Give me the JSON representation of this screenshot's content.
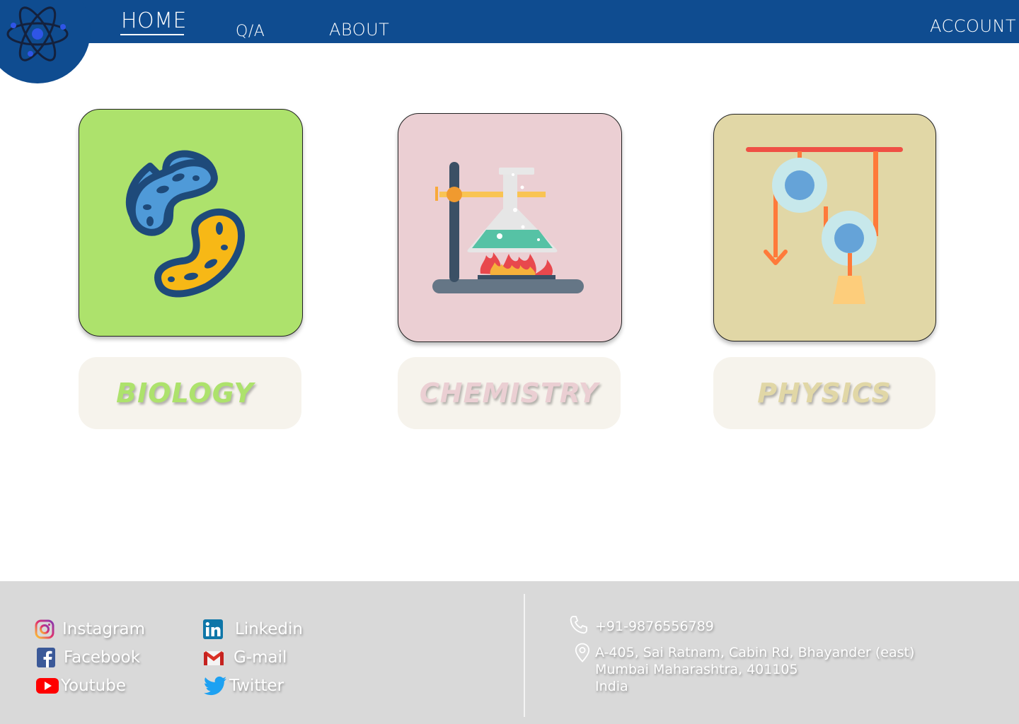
{
  "nav": {
    "home": "HOME",
    "qa": "Q/A",
    "about": "ABOUT",
    "account": "ACCOUNT"
  },
  "subjects": [
    {
      "label": "BIOLOGY",
      "icon": "bacteria-icon",
      "color": "#ade26c"
    },
    {
      "label": "CHEMISTRY",
      "icon": "lab-flask-burner-icon",
      "color": "#ebcfd3"
    },
    {
      "label": "PHYSICS",
      "icon": "pulley-icon",
      "color": "#e1d7a6"
    }
  ],
  "footer": {
    "social": [
      {
        "label": "Instagram",
        "icon": "instagram-icon"
      },
      {
        "label": "Facebook",
        "icon": "facebook-icon"
      },
      {
        "label": "Youtube",
        "icon": "youtube-icon"
      },
      {
        "label": "Linkedin",
        "icon": "linkedin-icon"
      },
      {
        "label": "G-mail",
        "icon": "gmail-icon"
      },
      {
        "label": "Twitter",
        "icon": "twitter-icon"
      }
    ],
    "phone": "+91-9876556789",
    "address": {
      "line1": "A-405, Sai Ratnam, Cabin Rd, Bhayander (east)",
      "line2": "Mumbai Maharashtra, 401105",
      "line3": "India"
    }
  },
  "colors": {
    "header": "#0f4c90",
    "footer": "#d9d9d9",
    "label_bg": "#f6f3ec"
  }
}
